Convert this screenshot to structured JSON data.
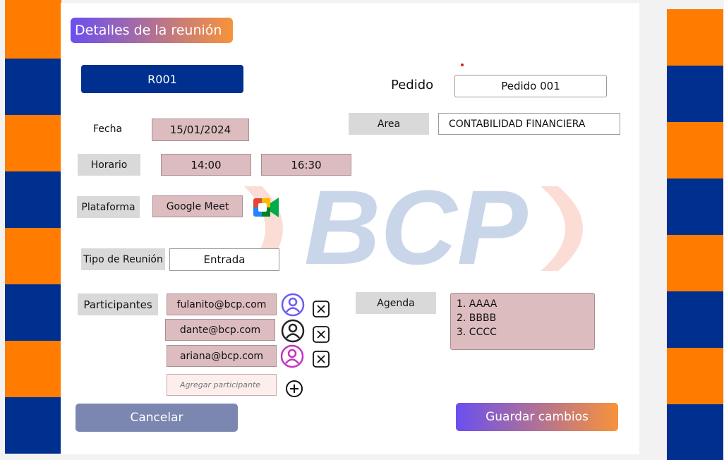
{
  "title": "Detalles de la reunión",
  "meeting_id": "R001",
  "pedido": {
    "label": "Pedido",
    "value": "Pedido 001"
  },
  "fecha": {
    "label": "Fecha",
    "value": "15/01/2024"
  },
  "area": {
    "label": "Area",
    "value": "CONTABILIDAD FINANCIERA"
  },
  "horario": {
    "label": "Horario",
    "start": "14:00",
    "end": "16:30"
  },
  "plataforma": {
    "label": "Plataforma",
    "value": "Google Meet",
    "icon": "google-meet-icon"
  },
  "tipo": {
    "label": "Tipo de Reunión",
    "value": "Entrada"
  },
  "participantes": {
    "label": "Participantes",
    "items": [
      {
        "email": "fulanito@bcp.com",
        "avatar_color": "#6a5cf0"
      },
      {
        "email": "dante@bcp.com",
        "avatar_color": "#222222"
      },
      {
        "email": "ariana@bcp.com",
        "avatar_color": "#c233c4"
      }
    ],
    "add_placeholder": "Agregar participante"
  },
  "agenda": {
    "label": "Agenda",
    "items": [
      "1. AAAA",
      "2. BBBB",
      "3. CCCC"
    ]
  },
  "buttons": {
    "cancel": "Cancelar",
    "save": "Guardar cambios"
  },
  "watermark": "BCP",
  "colors": {
    "orange": "#ff7c00",
    "blue": "#00308f",
    "pink_field": "#dcbcbf",
    "gray_label": "#d9d9d9",
    "cancel_btn": "#7b87b0",
    "gradient_start": "#6a4ff0",
    "gradient_end": "#f7933a"
  }
}
